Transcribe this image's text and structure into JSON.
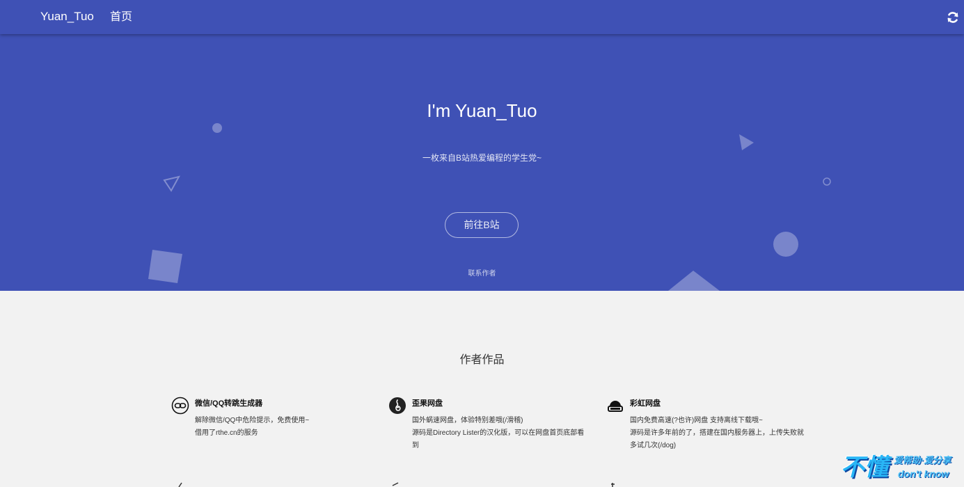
{
  "navbar": {
    "brand": "Yuan_Tuo",
    "home_label": "首页",
    "refresh_icon": "refresh-icon"
  },
  "hero": {
    "title": "I'm Yuan_Tuo",
    "subtitle": "一枚来自B站热爱编程的学生党~",
    "button_label": "前往B站",
    "contact_label": "联系作者"
  },
  "works": {
    "section_title": "作者作品",
    "items": [
      {
        "title": "微信/QQ转跳生成器",
        "icon": "link-chain-icon",
        "lines": [
          "解除微信/QQ中危险提示，免费使用~",
          "借用了rthe.cn的服务"
        ]
      },
      {
        "title": "歪果网盘",
        "icon": "flame-icon",
        "lines": [
          "国外蜗速网盘，体验特别差哦(/滑稽)",
          "源码是Directory Lister的汉化版，可以在网盘首页底部看到"
        ]
      },
      {
        "title": "彩虹网盘",
        "icon": "cloud-drive-icon",
        "lines": [
          "国内免费高速(?也许)网盘 支持离线下载哦~",
          "源码是许多年前的了，搭建在国内服务器上，上传失败就多试几次(/dog)"
        ]
      }
    ]
  },
  "watermark": {
    "big": "不懂",
    "small_top": "爱帮助·爱分享",
    "small_bottom": "don't know"
  },
  "colors": {
    "primary": "#3f51b5",
    "page_bg": "#f2f2f2"
  }
}
